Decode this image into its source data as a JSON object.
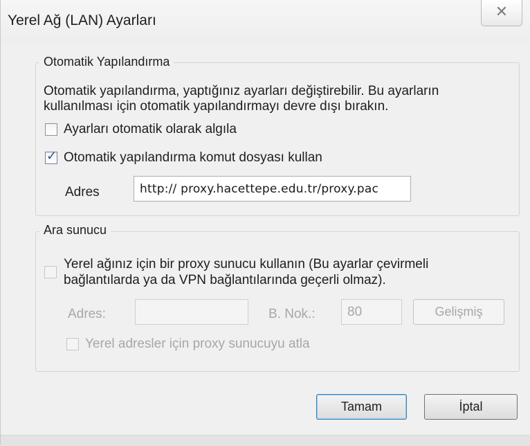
{
  "window": {
    "title": "Yerel Ağ (LAN) Ayarları",
    "close_glyph": "✕"
  },
  "auto_config": {
    "group_label": "Otomatik Yapılandırma",
    "description_line1": "Otomatik yapılandırma, yaptığınız ayarları değiştirebilir. Bu ayarların",
    "description_line2": "kullanılması için otomatik yapılandırmayı devre dışı bırakın.",
    "detect_label": "Ayarları otomatik olarak algıla",
    "detect_checked": false,
    "script_label": "Otomatik yapılandırma komut dosyası kullan",
    "script_checked": true,
    "address_label": "Adres",
    "address_value": "http:// proxy.hacettepe.edu.tr/proxy.pac"
  },
  "proxy": {
    "group_label": "Ara sunucu",
    "use_proxy_line1": "Yerel ağınız için bir proxy sunucu kullanın (Bu ayarlar çevirmeli",
    "use_proxy_line2": "bağlantılarda ya da VPN bağlantılarında geçerli olmaz).",
    "use_proxy_checked": false,
    "address_label": "Adres:",
    "address_value": "",
    "port_label": "B. Nok.:",
    "port_value": "80",
    "advanced_button": "Gelişmiş",
    "bypass_label": "Yerel adresler için proxy sunucuyu atla",
    "bypass_checked": false
  },
  "buttons": {
    "ok": "Tamam",
    "cancel": "İptal"
  },
  "colors": {
    "dialog_bg": "#f0f0f0",
    "disabled_text": "#a7a7a7",
    "default_button_border": "#3c7fb1"
  }
}
